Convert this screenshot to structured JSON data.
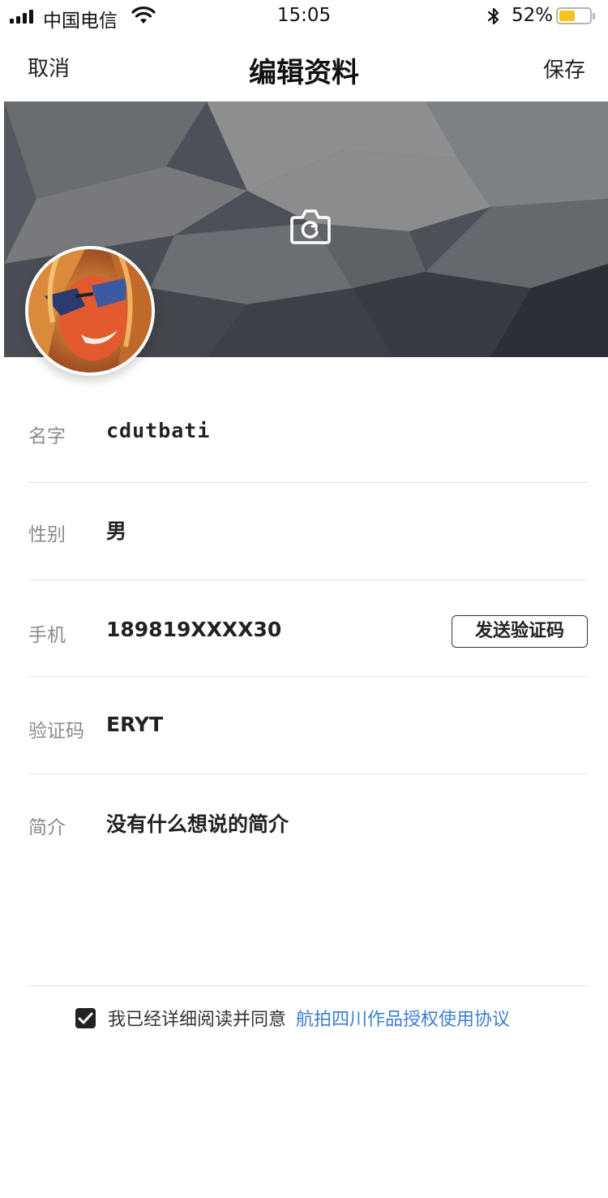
{
  "status_bar": {
    "carrier": "中国电信",
    "time": "15:05",
    "battery_percent": "52%",
    "battery_level": 0.52,
    "icons": [
      "signal-icon",
      "wifi-icon",
      "bluetooth-icon",
      "battery-icon"
    ]
  },
  "nav": {
    "cancel_label": "取消",
    "title": "编辑资料",
    "save_label": "保存"
  },
  "cover": {
    "camera_icon": "camera-icon"
  },
  "form": {
    "name": {
      "label": "名字",
      "value": "cdutbati"
    },
    "gender": {
      "label": "性别",
      "value": "男"
    },
    "phone": {
      "label": "手机",
      "value": "189819XXXX30",
      "button": "发送验证码"
    },
    "code": {
      "label": "验证码",
      "value": "ERYT"
    },
    "bio": {
      "label": "简介",
      "value": "没有什么想说的简介"
    }
  },
  "agreement": {
    "checked": true,
    "text": "我已经详细阅读并同意",
    "link": "航拍四川作品授权使用协议",
    "link_color": "#3a7fd0"
  }
}
